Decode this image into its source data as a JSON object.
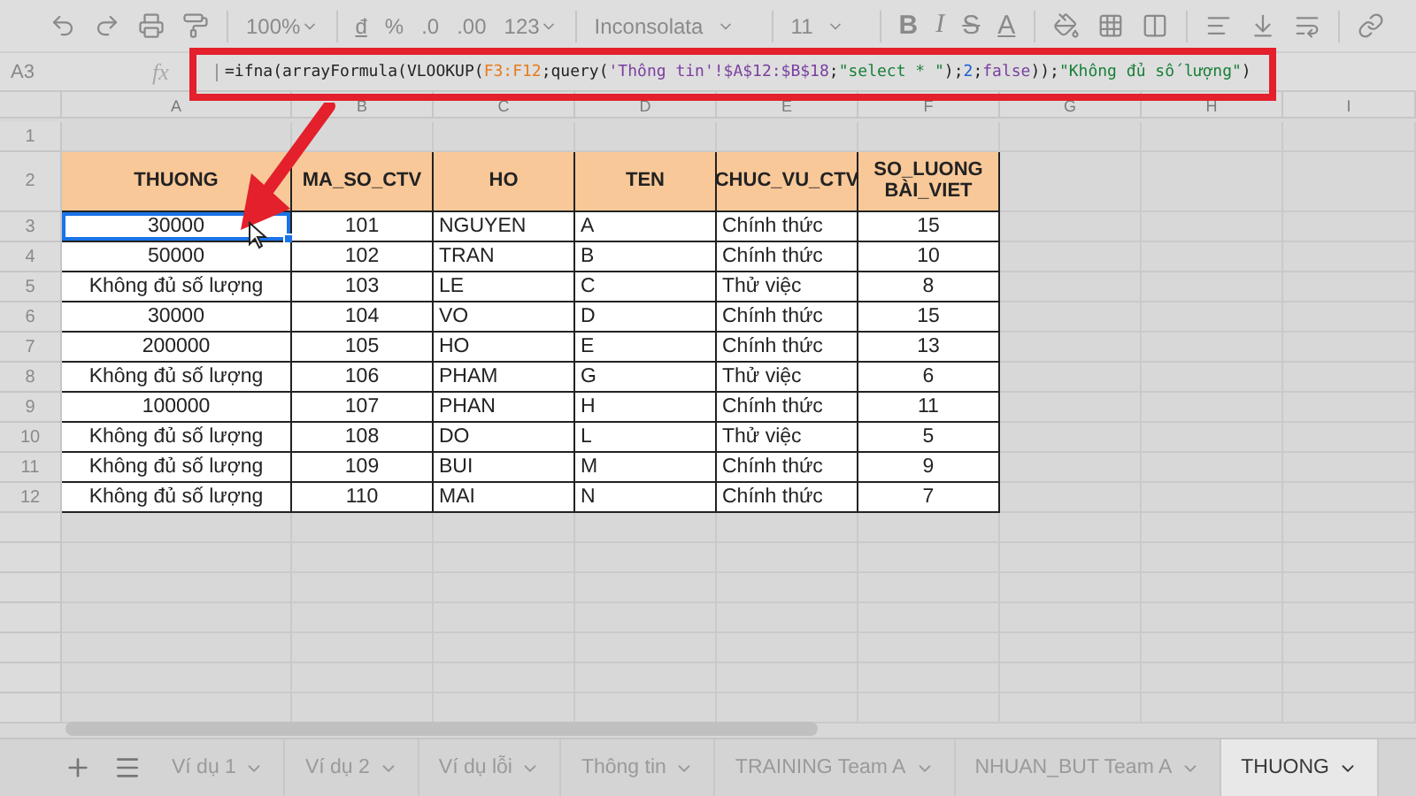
{
  "toolbar": {
    "zoom": "100%",
    "format_buttons": [
      "đ",
      "%",
      ".0",
      ".00",
      "123"
    ],
    "font": "Inconsolata",
    "font_size": "11",
    "style_buttons": [
      "B",
      "I",
      "S",
      "A"
    ]
  },
  "formula_bar": {
    "cell_ref": "A3",
    "fx": "fx",
    "formula": [
      {
        "kind": "plain",
        "text": "=ifna(arrayFormula(VLOOKUP("
      },
      {
        "kind": "range",
        "text": "F3:F12"
      },
      {
        "kind": "plain",
        "text": ";query("
      },
      {
        "kind": "ref",
        "text": "'Thông tin'!$A$12:$B$18"
      },
      {
        "kind": "plain",
        "text": ";"
      },
      {
        "kind": "string",
        "text": "\"select * \""
      },
      {
        "kind": "plain",
        "text": ");"
      },
      {
        "kind": "number",
        "text": "2"
      },
      {
        "kind": "plain",
        "text": ";"
      },
      {
        "kind": "ref",
        "text": "false"
      },
      {
        "kind": "plain",
        "text": "));"
      },
      {
        "kind": "string",
        "text": "\"Không đủ số lượng\""
      },
      {
        "kind": "plain",
        "text": ")"
      }
    ]
  },
  "column_letters": [
    "A",
    "B",
    "C",
    "D",
    "E",
    "F",
    "G",
    "H",
    "I"
  ],
  "row_numbers": [
    "1",
    "2",
    "3",
    "4",
    "5",
    "6",
    "7",
    "8",
    "9",
    "10",
    "11",
    "12"
  ],
  "table": {
    "columns": [
      "THUONG",
      "MA_SO_CTV",
      "HO",
      "TEN",
      "CHUC_VU_CTV",
      "SO_LUONG BÀI_VIET"
    ],
    "rows": [
      {
        "selected": true,
        "cells": [
          "30000",
          "101",
          "NGUYEN",
          "A",
          "Chính thức",
          "15"
        ]
      },
      {
        "selected": false,
        "cells": [
          "50000",
          "102",
          "TRAN",
          "B",
          "Chính thức",
          "10"
        ]
      },
      {
        "selected": false,
        "cells": [
          "Không đủ số lượng",
          "103",
          "LE",
          "C",
          "Thử việc",
          "8"
        ]
      },
      {
        "selected": false,
        "cells": [
          "30000",
          "104",
          "VO",
          "D",
          "Chính thức",
          "15"
        ]
      },
      {
        "selected": false,
        "cells": [
          "200000",
          "105",
          "HO",
          "E",
          "Chính thức",
          "13"
        ]
      },
      {
        "selected": false,
        "cells": [
          "Không đủ số lượng",
          "106",
          "PHAM",
          "G",
          "Thử việc",
          "6"
        ]
      },
      {
        "selected": false,
        "cells": [
          "100000",
          "107",
          "PHAN",
          "H",
          "Chính thức",
          "11"
        ]
      },
      {
        "selected": false,
        "cells": [
          "Không đủ số lượng",
          "108",
          "DO",
          "L",
          "Thử việc",
          "5"
        ]
      },
      {
        "selected": false,
        "cells": [
          "Không đủ số lượng",
          "109",
          "BUI",
          "M",
          "Chính thức",
          "9"
        ]
      },
      {
        "selected": false,
        "cells": [
          "Không đủ số lượng",
          "110",
          "MAI",
          "N",
          "Chính thức",
          "7"
        ]
      }
    ]
  },
  "sheet_tabs": [
    {
      "label": "Ví dụ 1",
      "selected": false
    },
    {
      "label": "Ví dụ 2",
      "selected": false
    },
    {
      "label": "Ví dụ lỗi",
      "selected": false
    },
    {
      "label": "Thông tin",
      "selected": false
    },
    {
      "label": "TRAINING Team A",
      "selected": false
    },
    {
      "label": "NHUAN_BUT Team A",
      "selected": false
    },
    {
      "label": "THUONG",
      "selected": true
    }
  ]
}
